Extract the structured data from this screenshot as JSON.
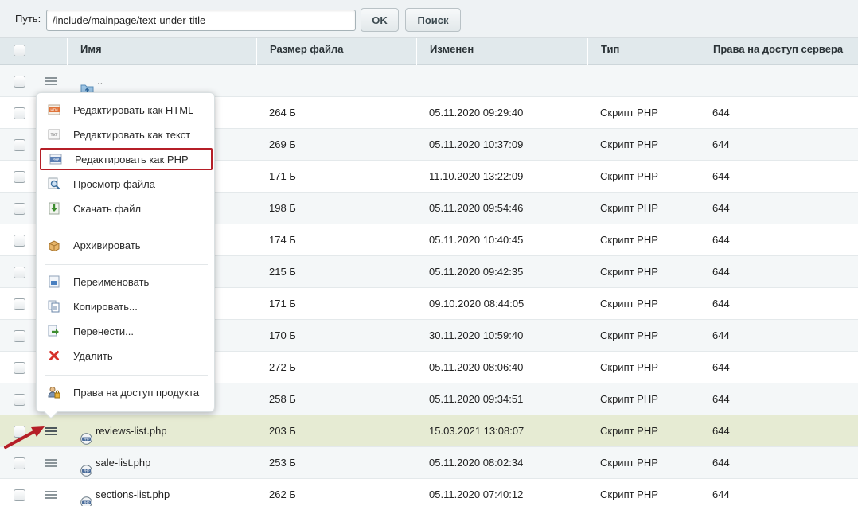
{
  "toolbar": {
    "path_label": "Путь:",
    "path_value": "/include/mainpage/text-under-title",
    "ok_label": "OK",
    "search_label": "Поиск"
  },
  "columns": {
    "name": "Имя",
    "size": "Размер файла",
    "modified": "Изменен",
    "type": "Тип",
    "permissions": "Права на доступ сервера"
  },
  "parent_row": {
    "label": ".."
  },
  "rows": [
    {
      "name": "",
      "size": "264 Б",
      "modified": "05.11.2020 09:29:40",
      "type": "Скрипт PHP",
      "perm": "644"
    },
    {
      "name": "",
      "size": "269 Б",
      "modified": "05.11.2020 10:37:09",
      "type": "Скрипт PHP",
      "perm": "644"
    },
    {
      "name": "",
      "size": "171 Б",
      "modified": "11.10.2020 13:22:09",
      "type": "Скрипт PHP",
      "perm": "644"
    },
    {
      "name": "",
      "size": "198 Б",
      "modified": "05.11.2020 09:54:46",
      "type": "Скрипт PHP",
      "perm": "644"
    },
    {
      "name": "",
      "size": "174 Б",
      "modified": "05.11.2020 10:40:45",
      "type": "Скрипт PHP",
      "perm": "644"
    },
    {
      "name": "",
      "size": "215 Б",
      "modified": "05.11.2020 09:42:35",
      "type": "Скрипт PHP",
      "perm": "644"
    },
    {
      "name": "",
      "size": "171 Б",
      "modified": "09.10.2020 08:44:05",
      "type": "Скрипт PHP",
      "perm": "644"
    },
    {
      "name": "",
      "size": "170 Б",
      "modified": "30.11.2020 10:59:40",
      "type": "Скрипт PHP",
      "perm": "644"
    },
    {
      "name": "",
      "size": "272 Б",
      "modified": "05.11.2020 08:06:40",
      "type": "Скрипт PHP",
      "perm": "644"
    },
    {
      "name": "",
      "size": "258 Б",
      "modified": "05.11.2020 09:34:51",
      "type": "Скрипт PHP",
      "perm": "644"
    },
    {
      "name": "reviews-list.php",
      "size": "203 Б",
      "modified": "15.03.2021 13:08:07",
      "type": "Скрипт PHP",
      "perm": "644",
      "selected": true
    },
    {
      "name": "sale-list.php",
      "size": "253 Б",
      "modified": "05.11.2020 08:02:34",
      "type": "Скрипт PHP",
      "perm": "644"
    },
    {
      "name": "sections-list.php",
      "size": "262 Б",
      "modified": "05.11.2020 07:40:12",
      "type": "Скрипт PHP",
      "perm": "644"
    }
  ],
  "context_menu": {
    "items": [
      {
        "label": "Редактировать как HTML",
        "icon": "html-file-icon"
      },
      {
        "label": "Редактировать как текст",
        "icon": "txt-file-icon"
      },
      {
        "label": "Редактировать как PHP",
        "icon": "php-file-icon",
        "highlighted": true
      },
      {
        "label": "Просмотр файла",
        "icon": "magnifier-icon"
      },
      {
        "label": "Скачать файл",
        "icon": "download-icon"
      },
      {
        "label": "Архивировать",
        "icon": "archive-box-icon"
      },
      {
        "label": "Переименовать",
        "icon": "rename-icon"
      },
      {
        "label": "Копировать...",
        "icon": "copy-icon"
      },
      {
        "label": "Перенести...",
        "icon": "move-icon"
      },
      {
        "label": "Удалить",
        "icon": "delete-icon"
      },
      {
        "label": "Права на доступ продукта",
        "icon": "user-lock-icon"
      }
    ]
  },
  "colors": {
    "header_bg": "#e1e9ec",
    "selected_row": "#e6ebd3",
    "highlight_border": "#b51e27",
    "arrow": "#b51e27"
  }
}
